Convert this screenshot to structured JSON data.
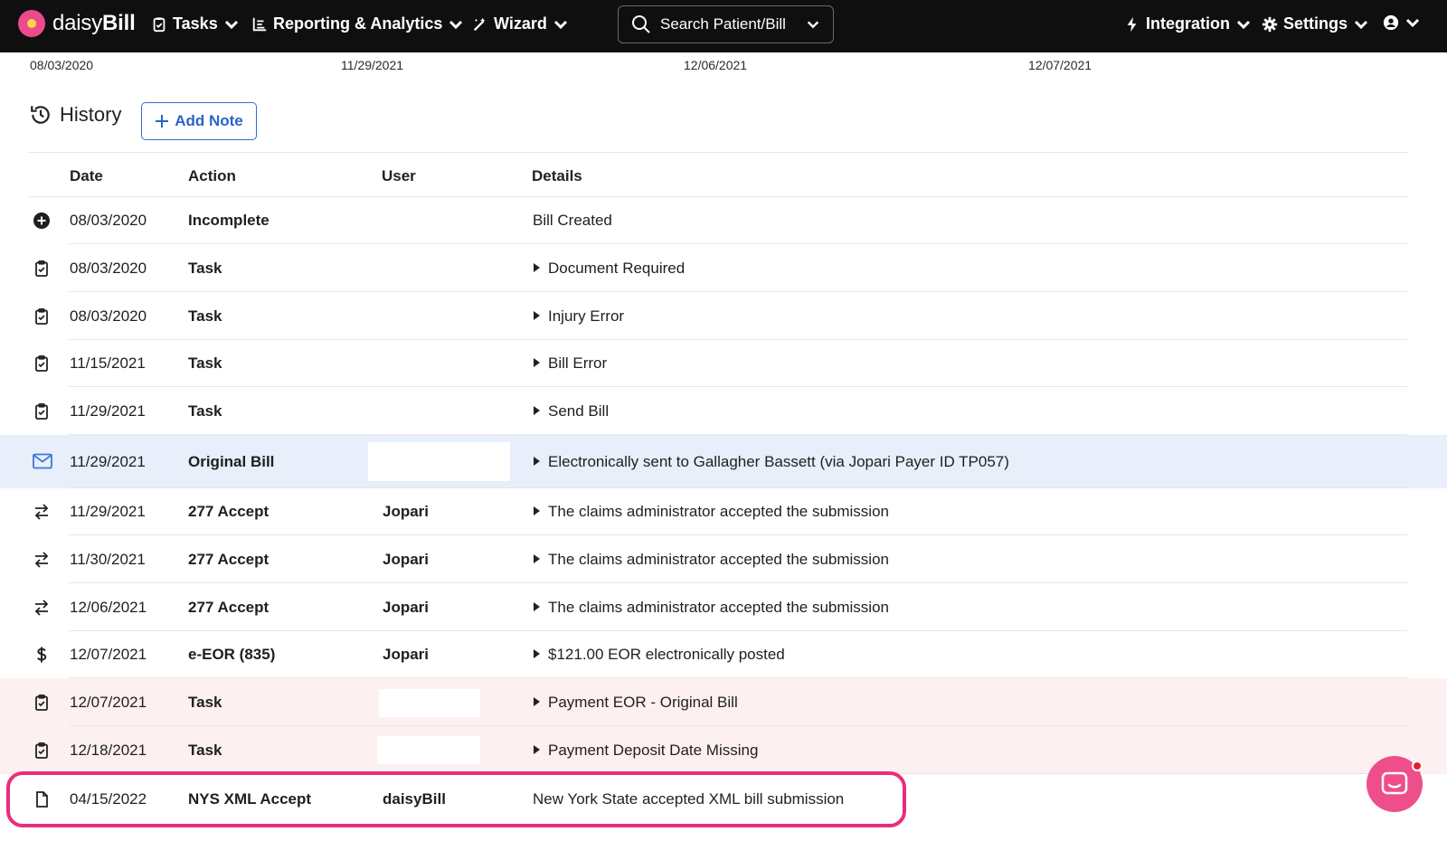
{
  "navbar": {
    "brand": {
      "part1": "daisy",
      "part2": "Bill"
    },
    "items": [
      {
        "label": "Tasks",
        "icon": "clipboard-icon"
      },
      {
        "label": "Reporting & Analytics",
        "icon": "chart-icon"
      },
      {
        "label": "Wizard",
        "icon": "wand-icon"
      }
    ],
    "search": {
      "placeholder": "Search Patient/Bill"
    },
    "right_items": [
      {
        "label": "Integration",
        "icon": "bolt-icon"
      },
      {
        "label": "Settings",
        "icon": "gear-icon"
      }
    ],
    "user_icon": "user-circle-icon"
  },
  "date_strip": [
    "08/03/2020",
    "11/29/2021",
    "12/06/2021",
    "12/07/2021"
  ],
  "history": {
    "title": "History",
    "add_note_label": "Add Note"
  },
  "table": {
    "headers": {
      "date": "Date",
      "action": "Action",
      "user": "User",
      "details": "Details"
    },
    "rows": [
      {
        "icon": "plus-circle-icon",
        "date": "08/03/2020",
        "action": "Incomplete",
        "user": "",
        "details": "Bill Created",
        "expandable": false,
        "bg": "#ffffff"
      },
      {
        "icon": "clipboard-check-icon",
        "date": "08/03/2020",
        "action": "Task",
        "user": "",
        "details": "Document Required",
        "expandable": true,
        "bg": "#ffffff"
      },
      {
        "icon": "clipboard-check-icon",
        "date": "08/03/2020",
        "action": "Task",
        "user": "",
        "details": "Injury Error",
        "expandable": true,
        "bg": "#ffffff"
      },
      {
        "icon": "clipboard-check-icon",
        "date": "11/15/2021",
        "action": "Task",
        "user": "",
        "details": "Bill Error",
        "expandable": true,
        "bg": "#ffffff"
      },
      {
        "icon": "clipboard-check-icon",
        "date": "11/29/2021",
        "action": "Task",
        "user": "",
        "details": "Send Bill",
        "expandable": true,
        "bg": "#ffffff"
      },
      {
        "icon": "envelope-icon",
        "date": "11/29/2021",
        "action": "Original Bill",
        "user": "",
        "details": "Electronically sent to Gallagher Bassett (via Jopari Payer ID TP057)",
        "expandable": true,
        "bg": "#e8eefa"
      },
      {
        "icon": "arrows-exchange-icon",
        "date": "11/29/2021",
        "action": "277 Accept",
        "user": "Jopari",
        "details": "The claims administrator accepted the submission",
        "expandable": true,
        "bg": "#ffffff"
      },
      {
        "icon": "arrows-exchange-icon",
        "date": "11/30/2021",
        "action": "277 Accept",
        "user": "Jopari",
        "details": "The claims administrator accepted the submission",
        "expandable": true,
        "bg": "#ffffff"
      },
      {
        "icon": "arrows-exchange-icon",
        "date": "12/06/2021",
        "action": "277 Accept",
        "user": "Jopari",
        "details": "The claims administrator accepted the submission",
        "expandable": true,
        "bg": "#ffffff"
      },
      {
        "icon": "dollar-icon",
        "date": "12/07/2021",
        "action": "e-EOR (835)",
        "user": "Jopari",
        "details": "$121.00 EOR electronically posted",
        "expandable": true,
        "bg": "#ffffff"
      },
      {
        "icon": "clipboard-check-icon",
        "date": "12/07/2021",
        "action": "Task",
        "user": "",
        "details": "Payment EOR - Original Bill",
        "expandable": true,
        "bg": "#fdf0f0"
      },
      {
        "icon": "clipboard-check-icon",
        "date": "12/18/2021",
        "action": "Task",
        "user": "",
        "details": "Payment Deposit Date Missing",
        "expandable": true,
        "bg": "#fdf0f0"
      },
      {
        "icon": "file-icon",
        "date": "04/15/2022",
        "action": "NYS XML Accept",
        "user": "daisyBill",
        "details": "New York State accepted XML bill submission",
        "expandable": false,
        "bg": "#ffffff"
      }
    ]
  },
  "colors": {
    "navbar_bg": "#0f0f10",
    "accent_blue": "#2864c8",
    "highlight": "#ea2d7a",
    "chat_pink": "#ee4f8b"
  },
  "chat": {
    "icon": "chat-bubble-icon"
  }
}
